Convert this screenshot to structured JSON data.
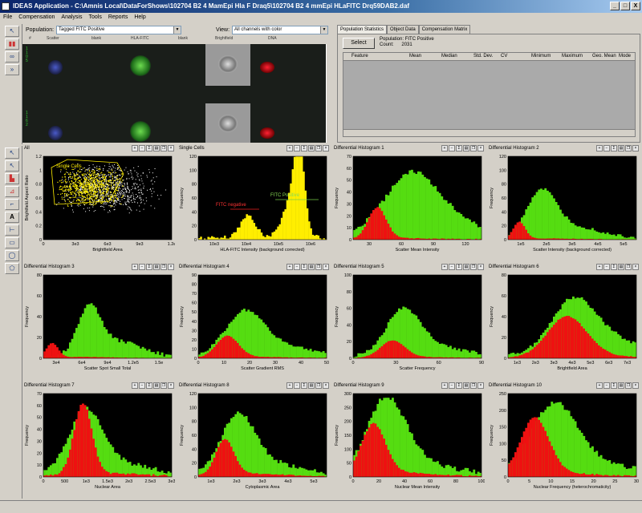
{
  "window": {
    "title": "IDEAS Application - C:\\Amnis Local\\DataForShows\\102704 B2 4 MamEpi Hla F Draq5\\102704 B2 4 mmEpi HLaFITC Drq59DAB2.daf",
    "controls": [
      "_",
      "□",
      "X"
    ]
  },
  "menu": [
    "File",
    "Compensation",
    "Analysis",
    "Tools",
    "Reports",
    "Help"
  ],
  "imagePanel": {
    "populationLabel": "Population:",
    "population": "Tagged FITC Positive",
    "viewLabel": "View:",
    "view": "All channels with color",
    "columns": [
      "#",
      "Scatter",
      "blank",
      "HLA-FITC",
      "blank",
      "Brightfield",
      "DNA"
    ],
    "rows": [
      {
        "id": "1105"
      },
      {
        "id": "1162"
      }
    ]
  },
  "statsPanel": {
    "tabs": [
      "Population Statistics",
      "Object Data",
      "Compensation Matrix"
    ],
    "selectLabel": "Select",
    "populationLabel": "Population:",
    "population": "FITC Positive",
    "countLabel": "Count:",
    "count": "2031",
    "headers": [
      "Feature",
      "Mean",
      "Median",
      "Std. Dev.",
      "CV",
      "Minimum",
      "Maximum",
      "Geo. Mean",
      "Mode"
    ]
  },
  "colors": {
    "red": "#ee1111",
    "green": "#55dd11",
    "yellow": "#ffee00",
    "bg": "#000000"
  },
  "plots": [
    {
      "title": "All",
      "type": "scatter",
      "xlabel": "Brightfield Area",
      "ylabel": "Brightfield Aspect Ratio",
      "xticks": [
        "0",
        "3e3",
        "6e3",
        "9e3",
        "1.2e"
      ],
      "yticks": [
        "0",
        "0.2",
        "0.4",
        "0.6",
        "0.8",
        "1",
        "1.2"
      ],
      "region": "Single Cells"
    },
    {
      "title": "Single Cells",
      "type": "hist-one",
      "xlabel": "HLA-FITC Intensity (background corrected)",
      "ylabel": "Frequency",
      "xticks": [
        "10e3",
        "10e4",
        "10e5",
        "10e6"
      ],
      "yticks": [
        "0",
        "20",
        "40",
        "60",
        "80",
        "100",
        "120"
      ],
      "ann": [
        "FITC negative",
        "FITC Positive"
      ]
    },
    {
      "title": "Differential Histogram 1",
      "xlabel": "Scatter Mean Intensity",
      "ylabel": "Frequency",
      "xticks": [
        "30",
        "60",
        "90",
        "120"
      ],
      "yticks": [
        "0",
        "10",
        "20",
        "30",
        "40",
        "50",
        "60",
        "70"
      ],
      "r": [
        0.05,
        0.18,
        0.22,
        0.1
      ],
      "g": [
        0.2,
        0.45,
        0.7,
        0.45
      ]
    },
    {
      "title": "Differential Histogram 2",
      "xlabel": "Scatter Intensity (background corrected)",
      "ylabel": "Frequency",
      "xticks": [
        "1e5",
        "2e5",
        "3e5",
        "4e5",
        "5e5"
      ],
      "yticks": [
        "0",
        "20",
        "40",
        "60",
        "80",
        "100",
        "120"
      ],
      "r": [
        0.02,
        0.08,
        0.12,
        0.1
      ],
      "g": [
        0.08,
        0.25,
        0.55,
        0.5
      ]
    },
    {
      "title": "Differential Histogram 3",
      "xlabel": "Scatter Spot Small Total",
      "ylabel": "Frequency",
      "xticks": [
        "3e4",
        "6e4",
        "9e4",
        "1.2e5",
        "1.5e"
      ],
      "yticks": [
        "0",
        "20",
        "40",
        "60",
        "80"
      ],
      "r": [
        0.02,
        0.06,
        0.1,
        0.12
      ],
      "g": [
        0.05,
        0.35,
        0.6,
        0.6
      ]
    },
    {
      "title": "Differential Histogram 4",
      "xlabel": "Scatter Gradient RMS",
      "ylabel": "Frequency",
      "xticks": [
        "0",
        "10",
        "20",
        "30",
        "40",
        "50"
      ],
      "yticks": [
        "0",
        "10",
        "20",
        "30",
        "40",
        "50",
        "60",
        "70",
        "80",
        "90"
      ],
      "r": [
        0.07,
        0.22,
        0.15,
        0.12
      ],
      "g": [
        0.12,
        0.35,
        0.5,
        0.55
      ]
    },
    {
      "title": "Differential Histogram 5",
      "xlabel": "Scatter Frequency",
      "ylabel": "Frequency",
      "xticks": [
        "0",
        "30",
        "60",
        "90"
      ],
      "yticks": [
        "0",
        "20",
        "40",
        "60",
        "80",
        "100"
      ],
      "r": [
        0.08,
        0.3,
        0.12,
        0.1
      ],
      "g": [
        0.1,
        0.38,
        0.55,
        0.45
      ]
    },
    {
      "title": "Differential Histogram 6",
      "xlabel": "Brightfield Area",
      "ylabel": "Frequency",
      "xticks": [
        "1e3",
        "2e3",
        "3e3",
        "4e3",
        "5e3",
        "6e3",
        "7e3"
      ],
      "yticks": [
        "0",
        "20",
        "40",
        "60",
        "80"
      ],
      "r": [
        0.15,
        0.45,
        0.28,
        0.25
      ],
      "g": [
        0.15,
        0.5,
        0.6,
        0.7
      ]
    },
    {
      "title": "Differential Histogram 7",
      "xlabel": "Nuclear Area",
      "ylabel": "Frequency",
      "xticks": [
        "0",
        "500",
        "1e3",
        "1.5e3",
        "2e3",
        "2.5e3",
        "3e3"
      ],
      "yticks": [
        "0",
        "10",
        "20",
        "30",
        "40",
        "50",
        "60",
        "70"
      ],
      "r": [
        0.05,
        0.3,
        0.5,
        0.25
      ],
      "g": [
        0.1,
        0.32,
        0.75,
        0.38
      ]
    },
    {
      "title": "Differential Histogram 8",
      "xlabel": "Cytoplasmic Area",
      "ylabel": "Frequency",
      "xticks": [
        "1e3",
        "2e3",
        "3e3",
        "4e3",
        "5e3"
      ],
      "yticks": [
        "0",
        "20",
        "40",
        "60",
        "80",
        "100",
        "120"
      ],
      "r": [
        0.05,
        0.2,
        0.25,
        0.3
      ],
      "g": [
        0.1,
        0.3,
        0.7,
        0.4
      ]
    },
    {
      "title": "Differential Histogram 9",
      "xlabel": "Nuclear Mean Intensity",
      "ylabel": "Frequency",
      "xticks": [
        "0",
        "20",
        "40",
        "60",
        "80",
        "100"
      ],
      "yticks": [
        "0",
        "50",
        "100",
        "150",
        "200",
        "250",
        "300"
      ],
      "r": [
        0.08,
        0.15,
        0.35,
        0.4
      ],
      "g": [
        0.12,
        0.25,
        0.9,
        0.3
      ]
    },
    {
      "title": "Differential Histogram 10",
      "xlabel": "Nuclear Frequency (heterochromaticity)",
      "ylabel": "Frequency",
      "xticks": [
        "0",
        "5",
        "10",
        "15",
        "20",
        "25",
        "30"
      ],
      "yticks": [
        "0",
        "50",
        "100",
        "150",
        "200",
        "250"
      ],
      "r": [
        0.1,
        0.2,
        0.4,
        0.3
      ],
      "g": [
        0.15,
        0.35,
        0.8,
        0.4
      ]
    }
  ]
}
